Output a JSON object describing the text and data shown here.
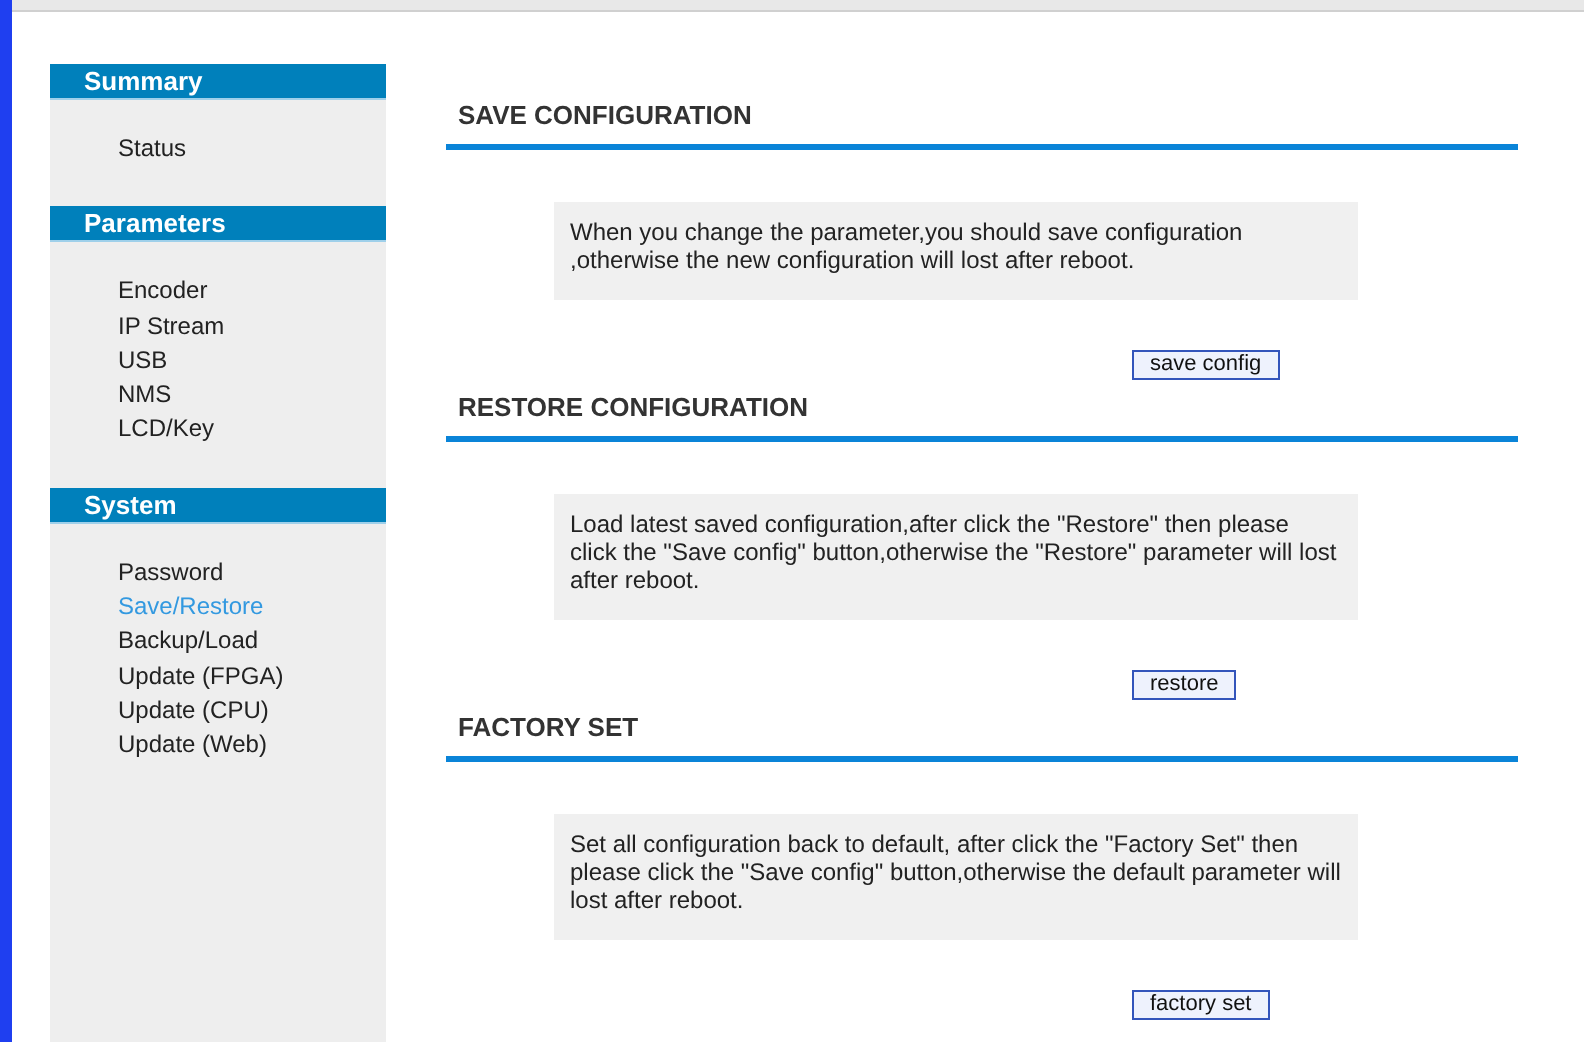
{
  "sidebar": [
    {
      "title": "Summary",
      "items": [
        {
          "label": "Status",
          "selected": false
        }
      ]
    },
    {
      "title": "Parameters",
      "items": [
        {
          "label": "Encoder",
          "selected": false
        },
        {
          "label": "IP Stream",
          "selected": false
        },
        {
          "label": "USB",
          "selected": false
        },
        {
          "label": "NMS",
          "selected": false
        },
        {
          "label": "LCD/Key",
          "selected": false
        }
      ]
    },
    {
      "title": "System",
      "items": [
        {
          "label": "Password",
          "selected": false
        },
        {
          "label": "Save/Restore",
          "selected": true
        },
        {
          "label": "Backup/Load",
          "selected": false
        },
        {
          "label": "Update (FPGA)",
          "selected": false
        },
        {
          "label": "Update (CPU)",
          "selected": false
        },
        {
          "label": "Update (Web)",
          "selected": false
        }
      ]
    }
  ],
  "sections": [
    {
      "title": "SAVE CONFIGURATION",
      "note": "When you change the parameter,you should save configuration ,otherwise the new configuration will lost after reboot.",
      "button": "save config"
    },
    {
      "title": "RESTORE CONFIGURATION",
      "note": "Load latest saved configuration,after click the \"Restore\" then please click the \"Save config\" button,otherwise the \"Restore\" parameter will lost after reboot.",
      "button": "restore"
    },
    {
      "title": "FACTORY SET",
      "note": "Set all configuration back to default, after click the \"Factory Set\" then please click the \"Save config\" button,otherwise the default parameter will lost after reboot.",
      "button": "factory set"
    }
  ]
}
